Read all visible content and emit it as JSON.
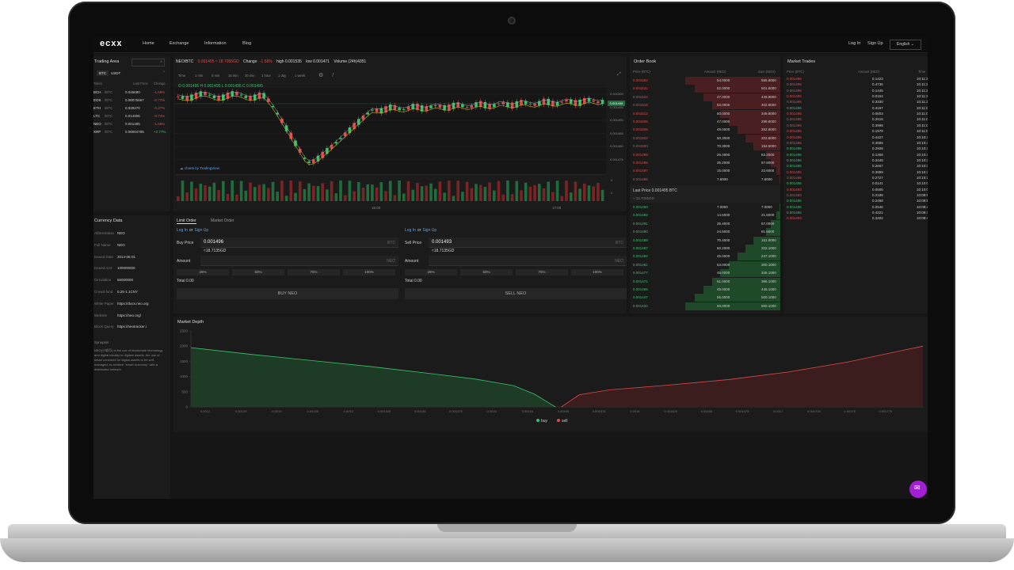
{
  "nav": {
    "logo": "ecxx",
    "links": [
      "Home",
      "Exchange",
      "Information",
      "Blog"
    ],
    "login": "Log In",
    "signup": "Sign Up",
    "language": "English"
  },
  "trading_area": {
    "title": "Trading Area",
    "tabs": [
      "BTC",
      "USDT"
    ],
    "columns": [
      "Token",
      "Last Price",
      "Change"
    ],
    "rows": [
      {
        "sym": "BCH",
        "quote": "/BTC",
        "price": "0.045680",
        "change": "-1.59%",
        "dir": "down"
      },
      {
        "sym": "EOS",
        "quote": "/BTC",
        "price": "0.00075667",
        "change": "-0.77%",
        "dir": "down"
      },
      {
        "sym": "ETH",
        "quote": "/BTC",
        "price": "0.029270",
        "change": "-0.27%",
        "dir": "down"
      },
      {
        "sym": "LTC",
        "quote": "/BTC",
        "price": "0.014306",
        "change": "-0.74%",
        "dir": "down"
      },
      {
        "sym": "NEO",
        "quote": "/BTC",
        "price": "0.001495",
        "change": "-1.58%",
        "dir": "down"
      },
      {
        "sym": "XRP",
        "quote": "/BTC",
        "price": "0.00004785",
        "change": "+2.77%",
        "dir": "up"
      }
    ]
  },
  "ticker": {
    "pair": "NEO/BTC",
    "price": "0.001495 ≈ 18.7055GD",
    "change_label": "Change",
    "change": "-1.58%",
    "high": "high 0.001535",
    "low": "low 0.001471",
    "volume": "Volume (24h)4351"
  },
  "intervals": [
    "Time",
    "1 min",
    "5 min",
    "15 min",
    "30 min",
    "1 hour",
    "1 day",
    "1 week"
  ],
  "ohlc": "O 0.001495  H 0.001495  L 0.001495  C 0.001495",
  "chart_credit": "charts by TradingView",
  "chart_axis": {
    "y_ticks": [
      "0.001500",
      "0.001495",
      "0.001490",
      "0.001485",
      "0.001480",
      "0.001475"
    ],
    "x_ticks": [
      "16:00",
      "17:00"
    ],
    "vol_ticks": [
      "4",
      "2"
    ]
  },
  "currency_data": {
    "title": "Currency Data",
    "rows": [
      {
        "k": "Abbreviation",
        "v": "NEO"
      },
      {
        "k": "Full Name",
        "v": "NEO"
      },
      {
        "k": "Issued Date",
        "v": "2014-06-01"
      },
      {
        "k": "Issued Amt",
        "v": "100000000"
      },
      {
        "k": "Circulation",
        "v": "65000000"
      },
      {
        "k": "Crowd-fund",
        "v": "0.25-1.1CNY"
      },
      {
        "k": "White Paper",
        "v": "https://docs.neo.org"
      },
      {
        "k": "Website",
        "v": "https://neo.org/"
      },
      {
        "k": "Block Query",
        "v": "https://neotracker.i"
      }
    ],
    "synopsis_label": "Synopsis",
    "synopsis": "NEO(小蚁币) is the use of blockchain technology and digital identity to digitize assets, the use of smart contracts for digital assets to be self-managed, to achieve \"smart economy\" with a distributed network."
  },
  "order_form": {
    "tabs": [
      "Limit Order",
      "Market Order"
    ],
    "login_text": "Log In",
    "or_text": "or",
    "signup_text": "Sign Up",
    "buy": {
      "price_label": "Buy Price",
      "price": "0.001496",
      "unit": "BTC",
      "approx": "≈18.7135GD",
      "amount_label": "Amount",
      "amount_unit": "NEO",
      "pcts": [
        "25%",
        "50%",
        "75%",
        "100%"
      ],
      "total": "Total 0.00",
      "button": "BUY NEO"
    },
    "sell": {
      "price_label": "Sell Price",
      "price": "0.001493",
      "unit": "BTC",
      "approx": "≈18.7135GD",
      "amount_label": "Amount",
      "amount_unit": "NEO",
      "pcts": [
        "25%",
        "50%",
        "75%",
        "100%"
      ],
      "total": "Total 0.00",
      "button": "SELL NEO"
    }
  },
  "order_book": {
    "title": "Order Book",
    "columns": [
      "Price (BTC)",
      "Amount (NEO)",
      "Sum (NEO)"
    ],
    "asks": [
      {
        "p": "0.001552",
        "a": "54.0000",
        "s": "555.8000",
        "d": 1.0
      },
      {
        "p": "0.001531",
        "a": "52.0000",
        "s": "501.8000",
        "d": 0.9
      },
      {
        "p": "0.001524",
        "a": "47.0000",
        "s": "449.8000",
        "d": 0.81
      },
      {
        "p": "0.001518",
        "a": "53.0000",
        "s": "402.8000",
        "d": 0.72
      },
      {
        "p": "0.001512",
        "a": "50.0000",
        "s": "349.8000",
        "d": 0.63
      },
      {
        "p": "0.001508",
        "a": "47.0000",
        "s": "299.8000",
        "d": 0.54
      },
      {
        "p": "0.001505",
        "a": "49.0000",
        "s": "252.8000",
        "d": 0.45
      },
      {
        "p": "0.001502",
        "a": "50.3000",
        "s": "203.8000",
        "d": 0.37
      },
      {
        "p": "0.001500",
        "a": "70.3000",
        "s": "153.5000",
        "d": 0.28
      },
      {
        "p": "0.001499",
        "a": "25.4000",
        "s": "83.2000",
        "d": 0.15
      },
      {
        "p": "0.001498",
        "a": "35.2000",
        "s": "57.8000",
        "d": 0.1
      },
      {
        "p": "0.001497",
        "a": "15.0000",
        "s": "22.6000",
        "d": 0.04
      },
      {
        "p": "0.001496",
        "a": "7.6000",
        "s": "7.6000",
        "d": 0.01
      }
    ],
    "last_price": "Last Price 0.001495 BTC",
    "last_price_fiat": "≈ 18.7055GD",
    "bids": [
      {
        "p": "0.001493",
        "a": "7.0000",
        "s": "7.0000",
        "d": 0.01
      },
      {
        "p": "0.001492",
        "a": "14.6000",
        "s": "21.6000",
        "d": 0.04
      },
      {
        "p": "0.001491",
        "a": "35.4000",
        "s": "57.0000",
        "d": 0.1
      },
      {
        "p": "0.001490",
        "a": "24.5000",
        "s": "81.5000",
        "d": 0.15
      },
      {
        "p": "0.001489",
        "a": "70.4000",
        "s": "151.9000",
        "d": 0.28
      },
      {
        "p": "0.001487",
        "a": "50.2000",
        "s": "202.1000",
        "d": 0.37
      },
      {
        "p": "0.001484",
        "a": "45.0000",
        "s": "247.1000",
        "d": 0.45
      },
      {
        "p": "0.001481",
        "a": "53.0000",
        "s": "300.1000",
        "d": 0.54
      },
      {
        "p": "0.001477",
        "a": "45.0000",
        "s": "345.1000",
        "d": 0.63
      },
      {
        "p": "0.001471",
        "a": "51.0000",
        "s": "396.1000",
        "d": 0.72
      },
      {
        "p": "0.001465",
        "a": "49.0000",
        "s": "445.1000",
        "d": 0.81
      },
      {
        "p": "0.001447",
        "a": "55.0000",
        "s": "500.1000",
        "d": 0.9
      },
      {
        "p": "0.001432",
        "a": "50.0000",
        "s": "550.1000",
        "d": 1.0
      }
    ]
  },
  "market_trades": {
    "title": "Market Trades",
    "columns": [
      "Price (BTC)",
      "Amount (NEO)",
      "Time"
    ],
    "rows": [
      {
        "p": "0.001495",
        "a": "0.1423",
        "t": "10:11:3",
        "c": "red"
      },
      {
        "p": "0.001495",
        "a": "0.4736",
        "t": "10:11:3",
        "c": "red"
      },
      {
        "p": "0.001495",
        "a": "0.1445",
        "t": "10:11:3",
        "c": "red"
      },
      {
        "p": "0.001495",
        "a": "0.0154",
        "t": "10:11:3",
        "c": "red"
      },
      {
        "p": "0.001495",
        "a": "0.3330",
        "t": "10:11:3",
        "c": "red"
      },
      {
        "p": "0.001496",
        "a": "0.4167",
        "t": "10:11:0",
        "c": "green"
      },
      {
        "p": "0.001495",
        "a": "0.0603",
        "t": "10:11:0",
        "c": "red"
      },
      {
        "p": "0.001495",
        "a": "0.2616",
        "t": "10:11:0",
        "c": "red"
      },
      {
        "p": "0.001495",
        "a": "0.3998",
        "t": "10:11:0",
        "c": "red"
      },
      {
        "p": "0.001495",
        "a": "0.1970",
        "t": "10:11:0",
        "c": "red"
      },
      {
        "p": "0.001495",
        "a": "0.4427",
        "t": "10:10:4",
        "c": "red"
      },
      {
        "p": "0.001495",
        "a": "0.4586",
        "t": "10:10:4",
        "c": "red"
      },
      {
        "p": "0.001496",
        "a": "0.2928",
        "t": "10:10:4",
        "c": "green"
      },
      {
        "p": "0.001496",
        "a": "0.1308",
        "t": "10:10:4",
        "c": "green"
      },
      {
        "p": "0.001496",
        "a": "0.3448",
        "t": "10:10:3",
        "c": "green"
      },
      {
        "p": "0.001496",
        "a": "0.2657",
        "t": "10:10:3",
        "c": "green"
      },
      {
        "p": "0.001495",
        "a": "0.3899",
        "t": "10:10:3",
        "c": "red"
      },
      {
        "p": "0.001495",
        "a": "0.2727",
        "t": "10:10:3",
        "c": "red"
      },
      {
        "p": "0.001496",
        "a": "0.0141",
        "t": "10:10:0",
        "c": "green"
      },
      {
        "p": "0.001493",
        "a": "0.0505",
        "t": "10:10:0",
        "c": "red"
      },
      {
        "p": "0.001493",
        "a": "0.2188",
        "t": "10:09:5",
        "c": "red"
      },
      {
        "p": "0.001495",
        "a": "0.2468",
        "t": "10:09:5",
        "c": "green"
      },
      {
        "p": "0.001495",
        "a": "0.2546",
        "t": "10:09:4",
        "c": "green"
      },
      {
        "p": "0.001495",
        "a": "0.4221",
        "t": "10:09:4",
        "c": "green"
      },
      {
        "p": "0.001493",
        "a": "0.3402",
        "t": "10:09:4",
        "c": "red"
      }
    ]
  },
  "chart_data": {
    "type": "area",
    "title": "Market Depth",
    "ylim": [
      0,
      2500
    ],
    "y_ticks": [
      0,
      500,
      1000,
      1500,
      2000,
      2500
    ],
    "x_ticks": [
      "0.0012",
      "0.00125",
      "0.0013",
      "0.00135",
      "0.0014",
      "0.001425",
      "0.00145",
      "0.001475",
      "0.0015",
      "0.00153",
      "0.00155",
      "0.001575",
      "0.0016",
      "0.001625",
      "0.00165",
      "0.001675",
      "0.0017",
      "0.001725",
      "0.00175",
      "0.001775"
    ],
    "x_data_range": [
      0,
      19
    ],
    "series": [
      {
        "name": "buy",
        "color": "#39c26b",
        "x": [
          0,
          2,
          4,
          6,
          8,
          9.5,
          10.8,
          11.5,
          12.2
        ],
        "y": [
          1950,
          1730,
          1530,
          1330,
          1100,
          920,
          700,
          420,
          0
        ]
      },
      {
        "name": "sell",
        "color": "#e14a4a",
        "x": [
          12.4,
          13,
          14,
          16,
          18,
          20,
          22,
          24.5
        ],
        "y": [
          0,
          400,
          560,
          720,
          900,
          1150,
          1480,
          2000
        ]
      }
    ]
  }
}
